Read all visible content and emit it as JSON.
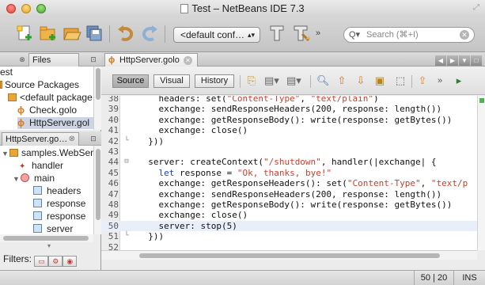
{
  "window": {
    "title": "Test – NetBeans IDE 7.3"
  },
  "toolbar": {
    "configuration": "<default conf…",
    "search_placeholder": "Search (⌘+I)",
    "icons": [
      "new-file-icon",
      "new-project-icon",
      "open-project-icon",
      "save-all-icon",
      "undo-icon",
      "redo-icon",
      "build-icon",
      "clean-build-icon",
      "more-icon"
    ]
  },
  "projects": {
    "tab_label": "Files",
    "items": [
      {
        "label": "est"
      },
      {
        "label": "Source Packages"
      },
      {
        "label": "<default package"
      },
      {
        "label": "Check.golo"
      },
      {
        "label": "HttpServer.gol"
      }
    ]
  },
  "navigator": {
    "tab_label": "HttpServer.go…",
    "items": [
      {
        "label": "samples.WebServe"
      },
      {
        "label": "handler"
      },
      {
        "label": "main"
      },
      {
        "label": "headers"
      },
      {
        "label": "response"
      },
      {
        "label": "response"
      },
      {
        "label": "server"
      }
    ],
    "filters_label": "Filters:"
  },
  "editor": {
    "tab_label": "HttpServer.golo",
    "modes": [
      "Source",
      "Visual",
      "History"
    ],
    "active_mode": "Source",
    "lines": [
      {
        "num": "38",
        "text": "    headers: set(\"Content-Type\", \"text/plain\")"
      },
      {
        "num": "39",
        "text": "    exchange: sendResponseHeaders(200, response: length())"
      },
      {
        "num": "40",
        "text": "    exchange: getResponseBody(): write(response: getBytes())"
      },
      {
        "num": "41",
        "text": "    exchange: close()"
      },
      {
        "num": "42",
        "text": "  }))"
      },
      {
        "num": "43",
        "text": ""
      },
      {
        "num": "44",
        "text": "  server: createContext(\"/shutdown\", handler(|exchange| {"
      },
      {
        "num": "45",
        "text": "    let response = \"Ok, thanks, bye!\""
      },
      {
        "num": "46",
        "text": "    exchange: getResponseHeaders(): set(\"Content-Type\", \"text/p"
      },
      {
        "num": "47",
        "text": "    exchange: sendResponseHeaders(200, response: length())"
      },
      {
        "num": "48",
        "text": "    exchange: getResponseBody(): write(response: getBytes())"
      },
      {
        "num": "49",
        "text": "    exchange: close()"
      },
      {
        "num": "50",
        "text": "    server: stop(5)"
      },
      {
        "num": "51",
        "text": "  }))"
      },
      {
        "num": "52",
        "text": ""
      }
    ]
  },
  "status": {
    "position": "50 | 20",
    "mode": "INS"
  },
  "colors": {
    "string": "#ce3d2e",
    "keyword": "#1a3fb3",
    "current_line": "#e9effa"
  }
}
